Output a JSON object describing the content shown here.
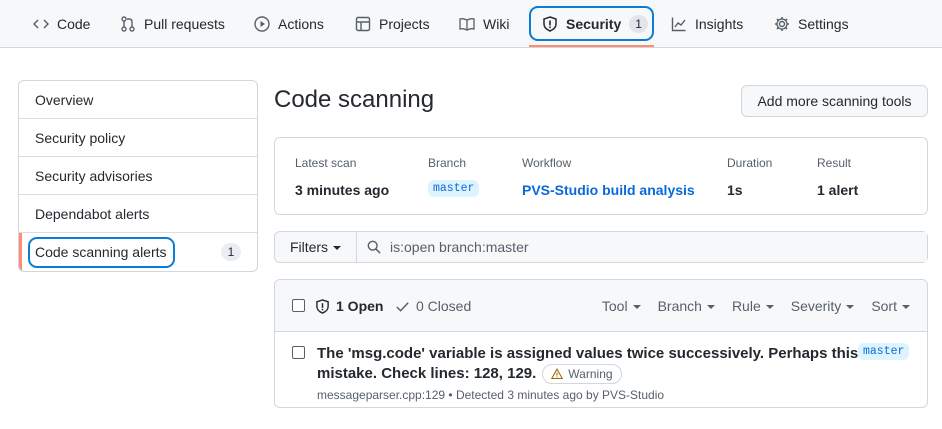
{
  "nav": {
    "items": [
      {
        "label": "Code",
        "icon": "code-icon"
      },
      {
        "label": "Pull requests",
        "icon": "pull-request-icon"
      },
      {
        "label": "Actions",
        "icon": "play-icon"
      },
      {
        "label": "Projects",
        "icon": "table-icon"
      },
      {
        "label": "Wiki",
        "icon": "book-icon"
      },
      {
        "label": "Security",
        "icon": "shield-icon",
        "counter": "1"
      },
      {
        "label": "Insights",
        "icon": "graph-icon"
      },
      {
        "label": "Settings",
        "icon": "gear-icon"
      }
    ],
    "active": "Security",
    "accent_color": "#fd8c73",
    "highlight_color": "#0a7bd6"
  },
  "sidebar": {
    "items": [
      {
        "label": "Overview"
      },
      {
        "label": "Security policy"
      },
      {
        "label": "Security advisories"
      },
      {
        "label": "Dependabot alerts"
      },
      {
        "label": "Code scanning alerts",
        "counter": "1"
      }
    ],
    "selected": "Code scanning alerts"
  },
  "main": {
    "title": "Code scanning",
    "add_button": "Add more scanning tools",
    "scan": {
      "latest_scan_label": "Latest scan",
      "latest_scan_value": "3 minutes ago",
      "branch_label": "Branch",
      "branch_value": "master",
      "workflow_label": "Workflow",
      "workflow_value": "PVS-Studio build analysis",
      "duration_label": "Duration",
      "duration_value": "1s",
      "result_label": "Result",
      "result_value": "1 alert"
    },
    "filters": {
      "button": "Filters",
      "search_value": "is:open branch:master"
    },
    "alerts": {
      "open_label": "1 Open",
      "closed_label": "0 Closed",
      "sort_menus": [
        "Tool",
        "Branch",
        "Rule",
        "Severity",
        "Sort"
      ],
      "rows": [
        {
          "title": "The 'msg.code' variable is assigned values twice successively. Perhaps this is a mistake. Check lines: 128, 129.",
          "branch": "master",
          "severity": "Warning",
          "meta": "messageparser.cpp:129 • Detected 3 minutes ago by PVS-Studio"
        }
      ]
    }
  }
}
